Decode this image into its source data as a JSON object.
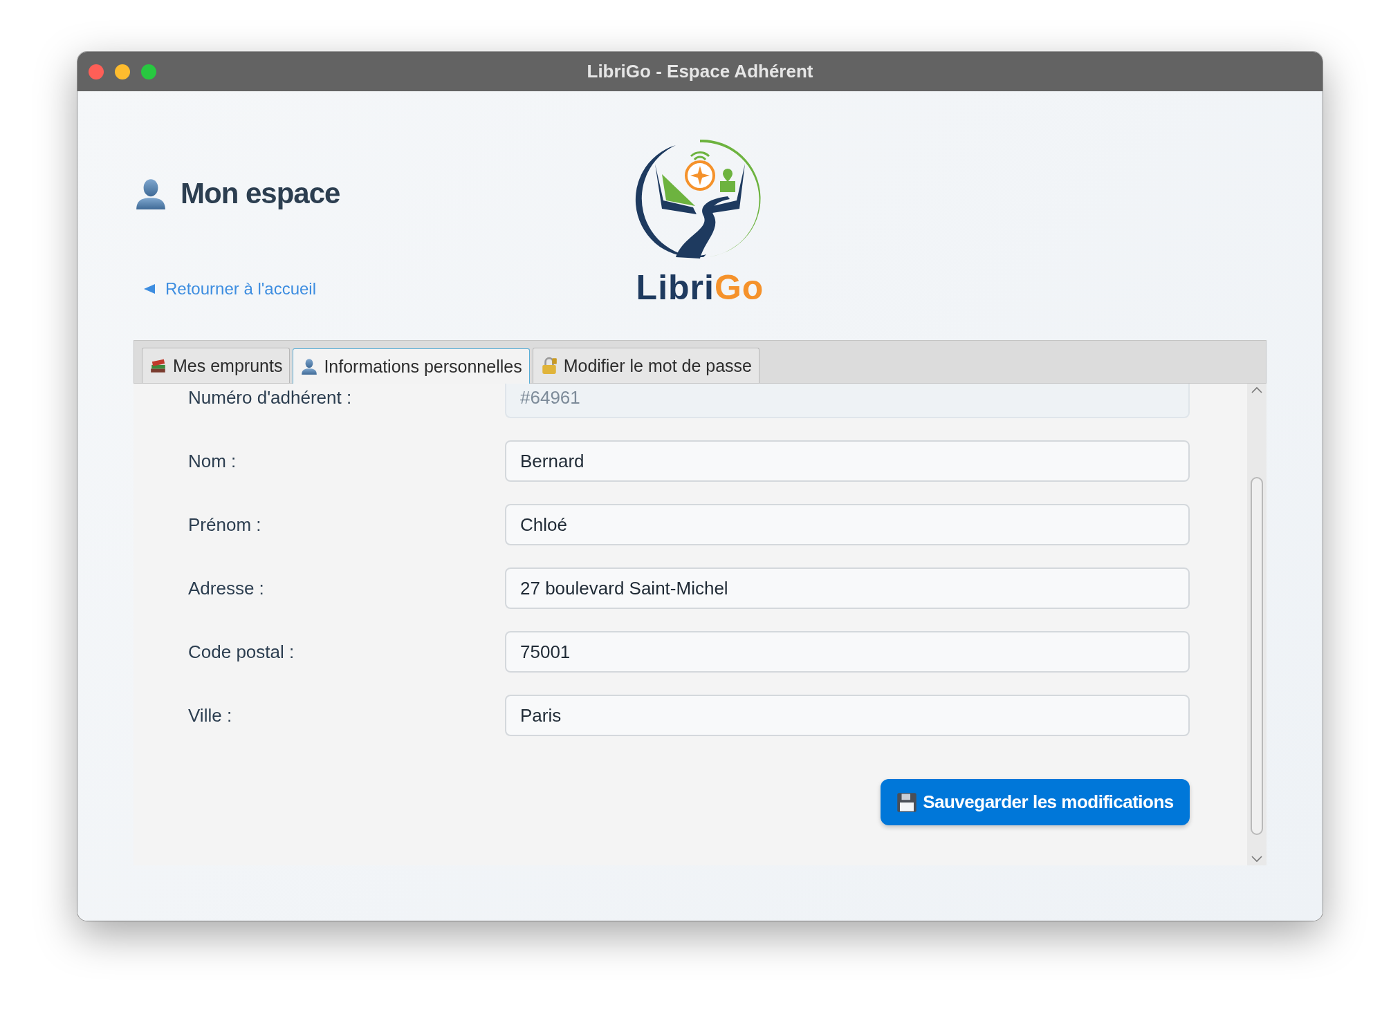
{
  "window": {
    "title": "LibriGo - Espace Adhérent"
  },
  "header": {
    "title": "Mon espace",
    "back_link": "Retourner à l'accueil"
  },
  "logo": {
    "wordmark": [
      "Libri",
      "Go"
    ]
  },
  "tabs": [
    {
      "label": "Mes emprunts",
      "selected": false,
      "kind": "books"
    },
    {
      "label": "Informations personnelles",
      "selected": true,
      "kind": "person"
    },
    {
      "label": "Modifier le mot de passe",
      "selected": false,
      "kind": "lock"
    }
  ],
  "fields": [
    {
      "label": "Numéro d'adhérent :",
      "value": "#64961",
      "disabled": true
    },
    {
      "label": "Nom :",
      "value": "Bernard",
      "disabled": false
    },
    {
      "label": "Prénom :",
      "value": "Chloé",
      "disabled": false
    },
    {
      "label": "Adresse :",
      "value": "27 boulevard Saint-Michel",
      "disabled": false
    },
    {
      "label": "Code postal :",
      "value": "75001",
      "disabled": false
    },
    {
      "label": "Ville :",
      "value": "Paris",
      "disabled": false
    }
  ],
  "save_button": {
    "label": "Sauvegarder les modifications"
  }
}
